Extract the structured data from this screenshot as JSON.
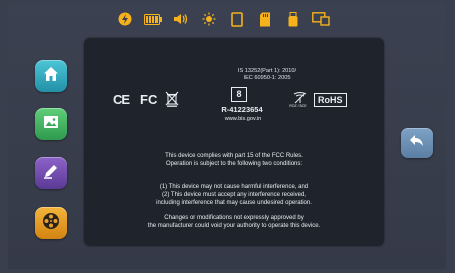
{
  "status_bar": {
    "icons": [
      "lightning-icon",
      "battery-icon",
      "volume-icon",
      "brightness-icon",
      "display-icon",
      "sd-card-icon",
      "usb-icon",
      "screen-mirror-icon"
    ],
    "accent_color": "#f5b21b"
  },
  "dock": {
    "items": [
      {
        "name": "home",
        "icon": "home-icon"
      },
      {
        "name": "gallery",
        "icon": "gallery-icon"
      },
      {
        "name": "edit",
        "icon": "edit-icon"
      },
      {
        "name": "film",
        "icon": "film-reel-icon"
      }
    ]
  },
  "regulatory": {
    "cert_line1": "IS 13252(Part 1): 2010/",
    "cert_line2": "IEC 60950-1: 2005",
    "ce": "CE",
    "fc": "FC",
    "bis_mark": "8",
    "r_number": "R-41223654",
    "website": "www.bis.gov.in",
    "antenna_caption": "ROZ / BCE",
    "rohs": "RoHS",
    "fcc_para1_line1": "This device complies with part 15 of the FCC Rules.",
    "fcc_para1_line2": "Operation is subject to the following two conditions:",
    "fcc_para2_line1": "(1) This device may not cause harmful interference, and",
    "fcc_para2_line2": "(2) This device must accept any interference received,",
    "fcc_para2_line3": "including interference that may cause undesired operation.",
    "fcc_para3_line1": "Changes or modifications not expressly approved by",
    "fcc_para3_line2": "the manufacturer could void your authority to operate this device."
  },
  "back_button": {
    "icon": "back-arrow-icon"
  }
}
